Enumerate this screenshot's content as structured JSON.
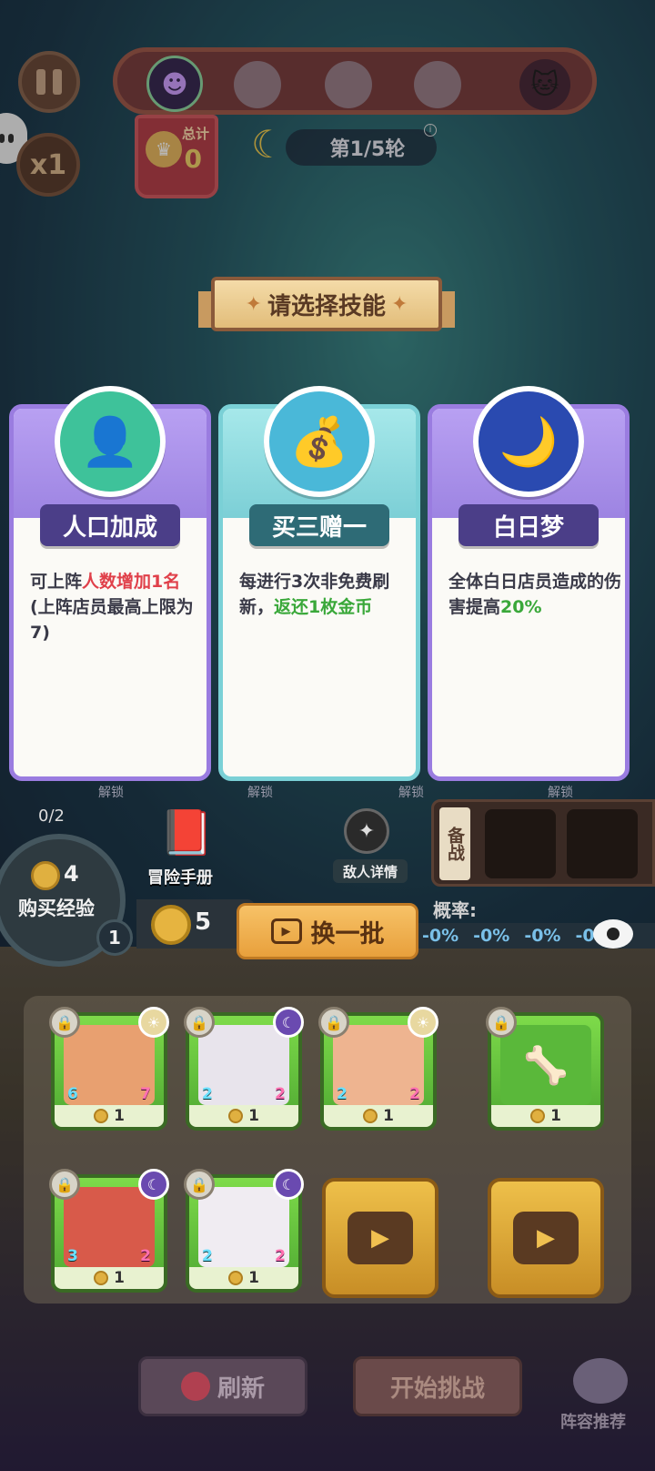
{
  "hud": {
    "total_label": "总计",
    "total_value": "0",
    "round_label": "第1/5轮",
    "speed_label": "x1"
  },
  "skill_select": {
    "title": "请选择技能",
    "cards": [
      {
        "name": "人口加成",
        "desc_parts": [
          "可上阵",
          "人数增加1名",
          "(上阵店员最高上限为7)"
        ],
        "emblem_icon": "person-plus-icon"
      },
      {
        "name": "买三赠一",
        "desc_parts": [
          "每进行3次非免费刷新，",
          "返还1枚金币"
        ],
        "emblem_icon": "gold-ingot-icon"
      },
      {
        "name": "白日梦",
        "desc_parts": [
          "全体白日店员造成的伤害提高",
          "20%"
        ],
        "emblem_icon": "dream-moon-icon"
      }
    ]
  },
  "board": {
    "unlock_label": "解锁",
    "adventure_label": "冒险手册",
    "enemy_label": "敌人详情",
    "reserve_label": "备战"
  },
  "economy": {
    "exp_progress": "0/2",
    "exp_cost": "4",
    "exp_label": "购买经验",
    "level": "1",
    "gold": "5",
    "refresh_batch_label": "换一批",
    "odds_label": "概率:",
    "odds": [
      "-0%",
      "-0%",
      "-0%",
      "-0%"
    ]
  },
  "shop": {
    "heroes": [
      {
        "price": "1",
        "stat_l": "6",
        "stat_r": "7",
        "trait": "sun"
      },
      {
        "price": "1",
        "stat_l": "2",
        "stat_r": "2",
        "trait": "moon"
      },
      {
        "price": "1",
        "stat_l": "2",
        "stat_r": "2",
        "trait": "sun"
      },
      {
        "price": "1",
        "item": "bone-icon"
      },
      {
        "price": "1",
        "stat_l": "3",
        "stat_r": "2",
        "trait": "moon"
      },
      {
        "price": "1",
        "stat_l": "2",
        "stat_r": "2",
        "trait": "moon"
      }
    ]
  },
  "footer": {
    "refresh_label": "刷新",
    "start_label": "开始挑战",
    "lineup_label": "阵容推荐"
  },
  "colors": {
    "card_purple": "#9a7ce0",
    "card_teal": "#7ad0d6",
    "highlight_red": "#e0404a",
    "highlight_green": "#3aa83a"
  }
}
